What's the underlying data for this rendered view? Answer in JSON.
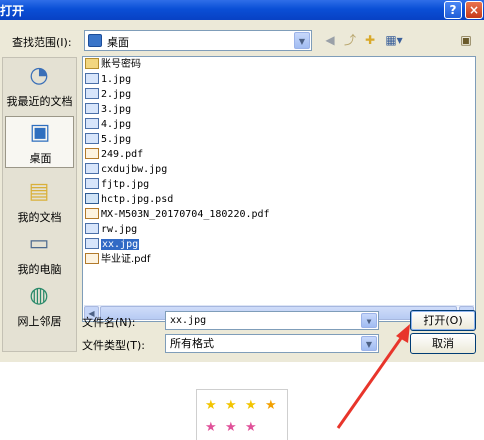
{
  "titlebar": {
    "title": "打开",
    "help_label": "?",
    "close_label": "×"
  },
  "lookin": {
    "label": "查找范围(I):",
    "value": "桌面"
  },
  "toolbar": {
    "icons": [
      "back-icon",
      "up-folder-icon",
      "new-folder-icon",
      "views-icon",
      "desktop-icon"
    ]
  },
  "places": [
    {
      "label": "我最近的文档",
      "icon": "recent-documents-icon"
    },
    {
      "label": "桌面",
      "icon": "desktop-icon",
      "selected": true
    },
    {
      "label": "我的文档",
      "icon": "my-documents-icon"
    },
    {
      "label": "我的电脑",
      "icon": "my-computer-icon"
    },
    {
      "label": "网上邻居",
      "icon": "network-places-icon"
    }
  ],
  "files": [
    {
      "name": "账号密码",
      "type": "folder"
    },
    {
      "name": "1.jpg",
      "type": "jpg"
    },
    {
      "name": "2.jpg",
      "type": "jpg"
    },
    {
      "name": "3.jpg",
      "type": "jpg"
    },
    {
      "name": "4.jpg",
      "type": "jpg"
    },
    {
      "name": "5.jpg",
      "type": "jpg"
    },
    {
      "name": "249.pdf",
      "type": "pdf"
    },
    {
      "name": "cxdujbw.jpg",
      "type": "jpg"
    },
    {
      "name": "fjtp.jpg",
      "type": "jpg"
    },
    {
      "name": "hctp.jpg.psd",
      "type": "psd"
    },
    {
      "name": "MX-M503N_20170704_180220.pdf",
      "type": "pdf"
    },
    {
      "name": "rw.jpg",
      "type": "jpg"
    },
    {
      "name": "xx.jpg",
      "type": "jpg",
      "selected": true
    },
    {
      "name": "毕业证.pdf",
      "type": "pdf"
    }
  ],
  "filename": {
    "label": "文件名(N):",
    "value": "xx.jpg"
  },
  "filetype": {
    "label": "文件类型(T):",
    "value": "所有格式"
  },
  "buttons": {
    "open_label": "打开(O)",
    "cancel_label": "取消"
  },
  "colors": {
    "titlebar": "#0a4fd6",
    "dialog_bg": "#ece9d8",
    "selection": "#316ac5",
    "arrow": "#e8352b"
  }
}
